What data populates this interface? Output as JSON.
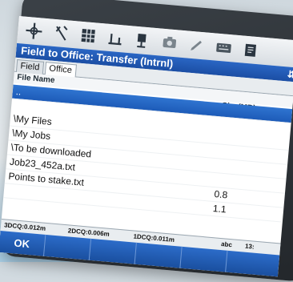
{
  "window": {
    "title": "Field to Office: Transfer (Intrnl)",
    "title_controls": "⇵"
  },
  "toolbar": {
    "icons": [
      "crosshair-icon",
      "survey-rod-icon",
      "grid-icon",
      "level-icon",
      "instrument-icon",
      "camera-icon",
      "pen-icon",
      "keyboard-icon",
      "files-icon"
    ]
  },
  "tabs": [
    {
      "label": "Field",
      "active": false
    },
    {
      "label": "Office",
      "active": true
    }
  ],
  "table": {
    "headers": {
      "name": "File Name",
      "size": "Size(MB)"
    },
    "rows": [
      {
        "name": "..",
        "size": "",
        "selected": true
      },
      {
        "name": "\\My Files",
        "size": "",
        "selected": false
      },
      {
        "name": "\\My Jobs",
        "size": "",
        "selected": false
      },
      {
        "name": "\\To be downloaded",
        "size": "",
        "selected": false
      },
      {
        "name": "Job23_452a.txt",
        "size": "",
        "selected": false
      },
      {
        "name": "Points to stake.txt",
        "size": "0.8",
        "selected": false
      },
      {
        "name": "",
        "size": "1.1",
        "selected": false
      }
    ]
  },
  "status": {
    "q3d": "3DCQ:0.012m",
    "q2d": "2DCQ:0.006m",
    "q1d": "1DCQ:0.011m",
    "input_mode": "abc",
    "time": "13:"
  },
  "softkeys": [
    "OK",
    "",
    "",
    "",
    "",
    ""
  ],
  "colors": {
    "accent": "#1d5bb8",
    "selection": "#2f74d0"
  }
}
